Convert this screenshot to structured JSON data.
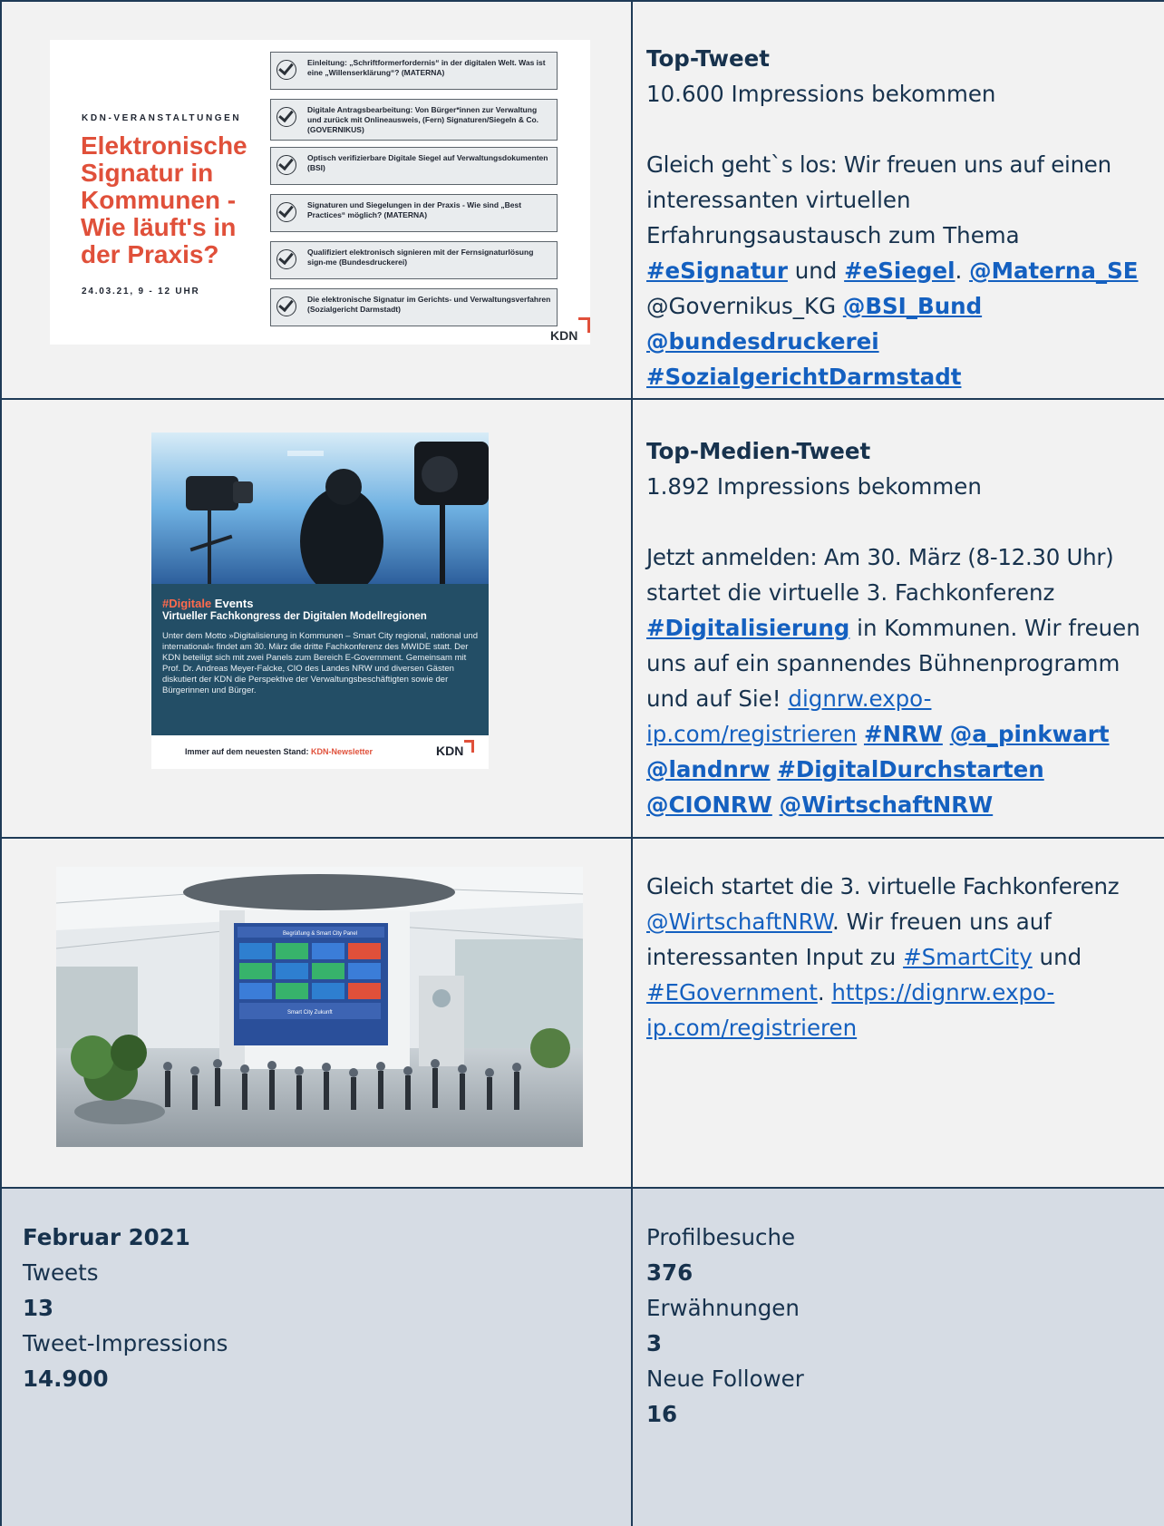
{
  "row1": {
    "image": {
      "kicker": "KDN-VERANSTALTUNGEN",
      "headline": "Elektronische Signatur in Kommunen - Wie läuft's in der Praxis?",
      "date": "24.03.21, 9 - 12 UHR",
      "agenda": [
        "Einleitung: „Schriftformerfordernis“ in der digitalen Welt. Was ist eine „Willenserklärung“? (MATERNA)",
        "Digitale Antragsbearbeitung: Von Bürger*innen zur Verwaltung und zurück mit Onlineausweis, (Fern) Signaturen/Siegeln & Co. (GOVERNIKUS)",
        "Optisch verifizierbare Digitale Siegel auf Verwaltungsdokumenten (BSI)",
        "Signaturen und Siegelungen in der Praxis - Wie sind „Best Practices“ möglich? (MATERNA)",
        "Qualifiziert elektronisch signieren mit der Fernsignaturlösung sign-me (Bundesdruckerei)",
        "Die elektronische Signatur im Gerichts- und Verwaltungsverfahren (Sozialgericht Darmstadt)"
      ],
      "logo": "KDN"
    },
    "label": "Top-Tweet",
    "impressions": "10.600 Impressions bekommen",
    "line1": "Gleich geht`s los: Wir freuen uns auf einen",
    "line2": "interessanten virtuellen",
    "line3": "Erfahrungsaustausch zum Thema",
    "tag_esignatur": "#eSignatur",
    "und": " und ",
    "tag_esiegel": "#eSiegel",
    "dot": ". ",
    "mention_materna": "@Materna_SE",
    "mention_governikus": "@Governikus_KG ",
    "mention_bsi": "@BSI_Bund",
    "mention_bundesdruckerei": "@bundesdruckerei",
    "tag_sozialgericht": "#SozialgerichtDarmstadt"
  },
  "row2": {
    "image": {
      "title_hash": "#Digitale",
      "title_rest": " Events",
      "subtitle": "Virtueller Fachkongress der Digitalen Modellregionen",
      "body": "Unter dem Motto »Digitalisierung in Kommunen – Smart City regional, national und international« findet am 30. März die dritte Fachkonferenz des MWIDE statt. Der KDN beteiligt sich mit zwei Panels zum Bereich E-Government. Gemeinsam mit Prof. Dr. Andreas Meyer-Falcke, CIO des Landes NRW und diversen Gästen diskutiert der KDN die Perspektive der Verwaltungsbeschäftigten sowie der Bürgerinnen und Bürger.",
      "footer_text": "Immer auf dem neuesten Stand: ",
      "footer_link": "KDN-Newsletter",
      "logo": "KDN"
    },
    "label": "Top-Medien-Tweet",
    "impressions": "1.892 Impressions bekommen",
    "line1": "Jetzt anmelden: Am 30. März (8-12.30 Uhr)",
    "line2": "startet die virtuelle 3. Fachkonferenz",
    "tag_digitalisierung": "#Digitalisierung",
    "line3_rest": " in Kommunen. Wir freuen",
    "line4": "uns auf ein spannendes Bühnenprogramm",
    "line5_pre": "und auf Sie! ",
    "link_part1": "dignrw.expo-",
    "link_part2": "ip.com/registrieren",
    "tag_nrw": "#NRW",
    "mention_pinkwart": "@a_pinkwart",
    "mention_landnrw": "@landnrw",
    "tag_digitaldurchstarten": "#DigitalDurchstarten",
    "mention_cionrw": "@CIONRW",
    "mention_wirtschaftnrw": "@WirtschaftNRW"
  },
  "row3": {
    "image": {
      "screen_title": "Begrüßung & Smart City Panel",
      "screen_footer": "Smart City Zukunft"
    },
    "line1": "Gleich startet die 3. virtuelle Fachkonferenz",
    "mention_wirtschaftnrw": "@WirtschaftNRW",
    "line2_rest": ". Wir freuen uns auf",
    "line3_pre": "interessanten Input zu ",
    "tag_smartcity": "#SmartCity",
    "line3_post": " und",
    "tag_egovernment": "#EGovernment",
    "dot": ". ",
    "link_part1": "https://dignrw.expo-",
    "link_part2": "ip.com/registrieren"
  },
  "stats_left": {
    "month": "Februar 2021",
    "tweets_label": "Tweets",
    "tweets_value": "13",
    "impressions_label": "Tweet-Impressions",
    "impressions_value": "14.900"
  },
  "stats_right": {
    "visits_label": "Profilbesuche",
    "visits_value": "376",
    "mentions_label": "Erwähnungen",
    "mentions_value": "3",
    "followers_label": "Neue Follower",
    "followers_value": "16"
  },
  "colors": {
    "cell_bg": "#f2f2f2",
    "stats_bg": "#d6dce4",
    "border": "#1f3b57",
    "text": "#17324d",
    "link": "#1460c0",
    "accent": "#e0503a"
  }
}
